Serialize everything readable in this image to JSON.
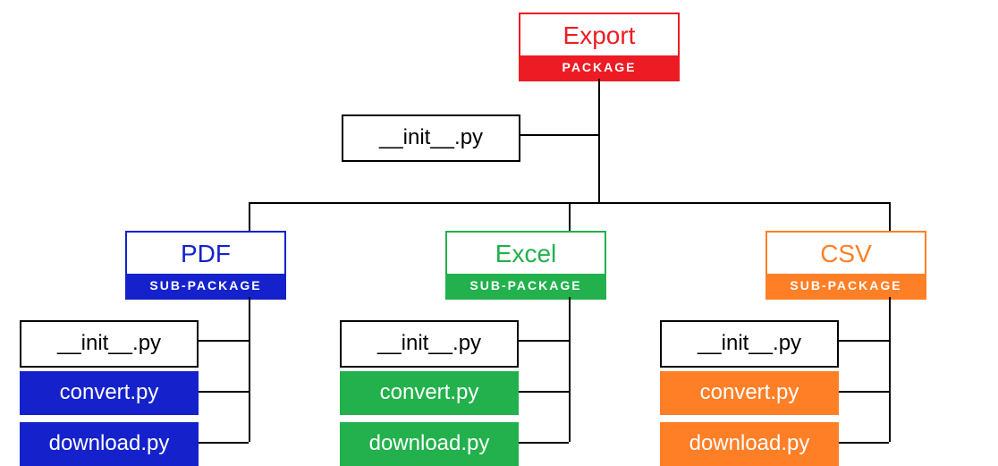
{
  "colors": {
    "red": "#ed1c24",
    "blue": "#1522cc",
    "green": "#22b14c",
    "orange": "#ff7f27"
  },
  "root": {
    "name": "Export",
    "tag": "PACKAGE",
    "init_file": "__init__.py"
  },
  "sub": [
    {
      "name": "PDF",
      "tag": "SUB-PACKAGE",
      "color_key": "blue",
      "files": [
        "__init__.py",
        "convert.py",
        "download.py"
      ]
    },
    {
      "name": "Excel",
      "tag": "SUB-PACKAGE",
      "color_key": "green",
      "files": [
        "__init__.py",
        "convert.py",
        "download.py"
      ]
    },
    {
      "name": "CSV",
      "tag": "SUB-PACKAGE",
      "color_key": "orange",
      "files": [
        "__init__.py",
        "convert.py",
        "download.py"
      ]
    }
  ]
}
